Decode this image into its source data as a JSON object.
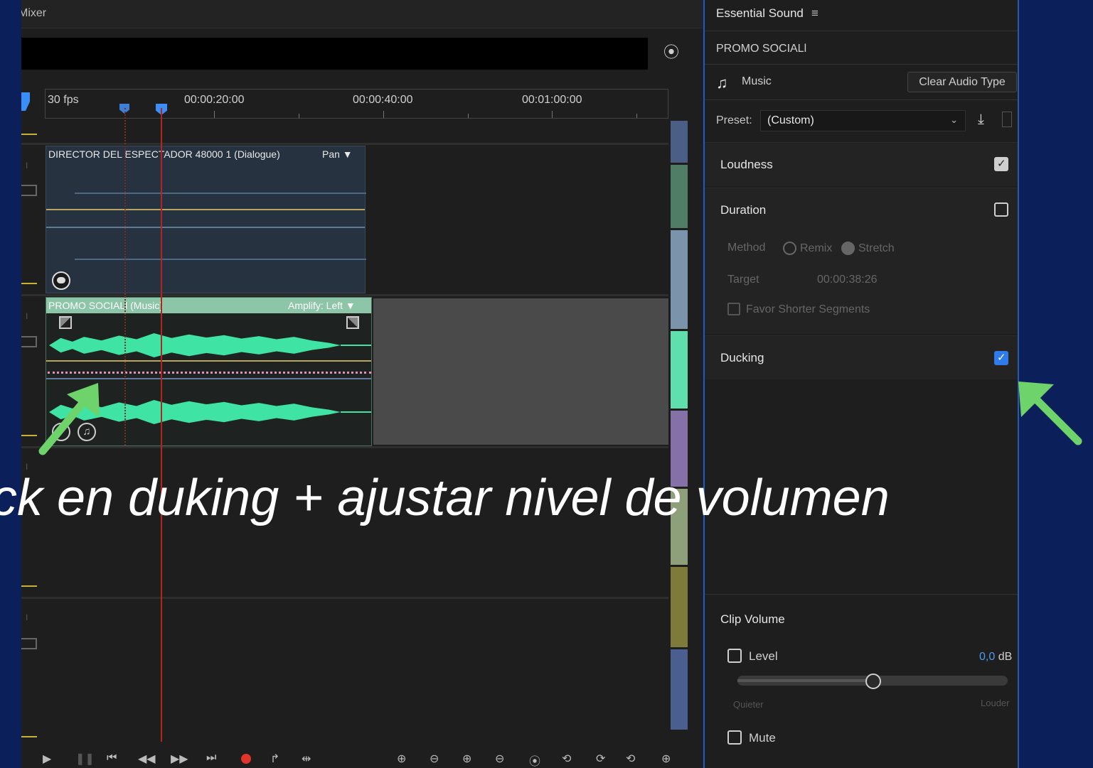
{
  "timeline": {
    "header_title": "Mixer",
    "fps": "30 fps",
    "timecodes": [
      "00:00:20:00",
      "00:00:40:00",
      "00:01:00:00"
    ],
    "dialogue_clip": {
      "label": "DIRECTOR DEL ESPECTADOR 48000 1 (Dialogue)",
      "effect": "Pan"
    },
    "music_clip": {
      "label": "PROMO SOCIALl (Music)",
      "effect": "Amplify: Left"
    },
    "scrollbar_colors": [
      "#4a5e86",
      "#4f7d66",
      "#7b93ab",
      "#5fdfae",
      "#8670a8",
      "#8da07a",
      "#7d7a3a",
      "#4a5e90"
    ]
  },
  "essential_sound": {
    "title": "Essential Sound",
    "menu_icon": "hamburger-icon",
    "clip_name": "PROMO SOCIALl",
    "audio_type": "Music",
    "clear_button": "Clear Audio Type",
    "preset_label": "Preset:",
    "preset_value": "(Custom)",
    "loudness": {
      "label": "Loudness",
      "checked": true
    },
    "duration": {
      "label": "Duration",
      "checked": false,
      "method_label": "Method",
      "method_options": [
        "Remix",
        "Stretch"
      ],
      "method_selected": "Stretch",
      "target_label": "Target",
      "target_value": "00:00:38:26",
      "favor_label": "Favor Shorter Segments"
    },
    "ducking": {
      "label": "Ducking",
      "checked": true
    },
    "clip_volume": {
      "title": "Clip Volume",
      "level_label": "Level",
      "level_value": "0,0",
      "level_unit": "dB",
      "quieter": "Quieter",
      "louder": "Louder",
      "mute_label": "Mute",
      "slider_fraction": 0.5
    }
  },
  "overlay": {
    "caption": "ick en duking  + ajustar nivel de volumen",
    "arrow_color": "#6ed36a"
  }
}
